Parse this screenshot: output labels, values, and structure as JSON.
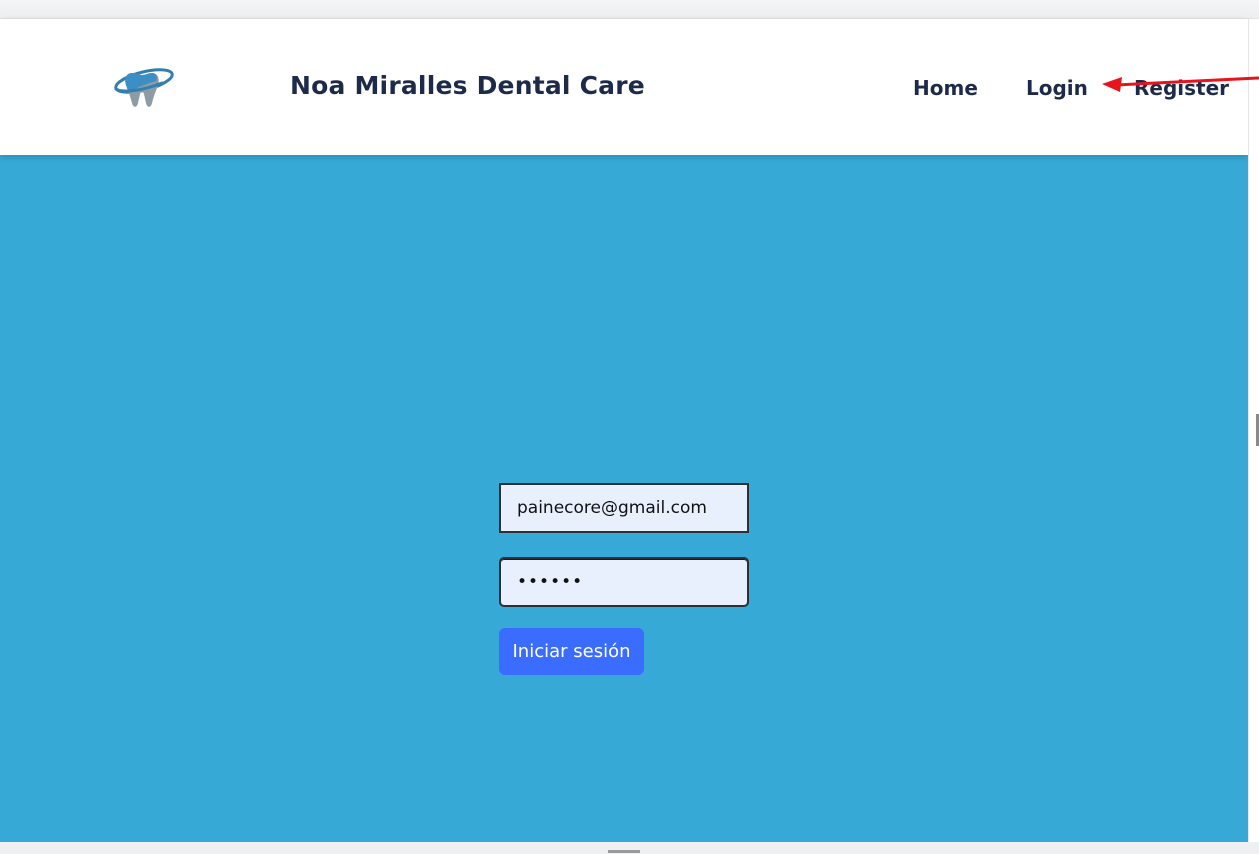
{
  "site": {
    "brand_title": "Noa Miralles Dental Care",
    "logo_icon": "tooth-with-orbit-icon"
  },
  "nav": {
    "home": "Home",
    "login": "Login",
    "register": "Register"
  },
  "login_form": {
    "email_value": "painecore@gmail.com",
    "password_value": "ababab",
    "submit_label": "Iniciar sesión"
  },
  "colors": {
    "page_background": "#37a9d6",
    "navbar_background": "#ffffff",
    "nav_text": "#1d2a4a",
    "input_background": "#e8f0fe",
    "button_background": "#3a6dff",
    "annotation_arrow": "#e8141c"
  },
  "annotation": {
    "icon": "red-arrow-pointer-icon"
  }
}
